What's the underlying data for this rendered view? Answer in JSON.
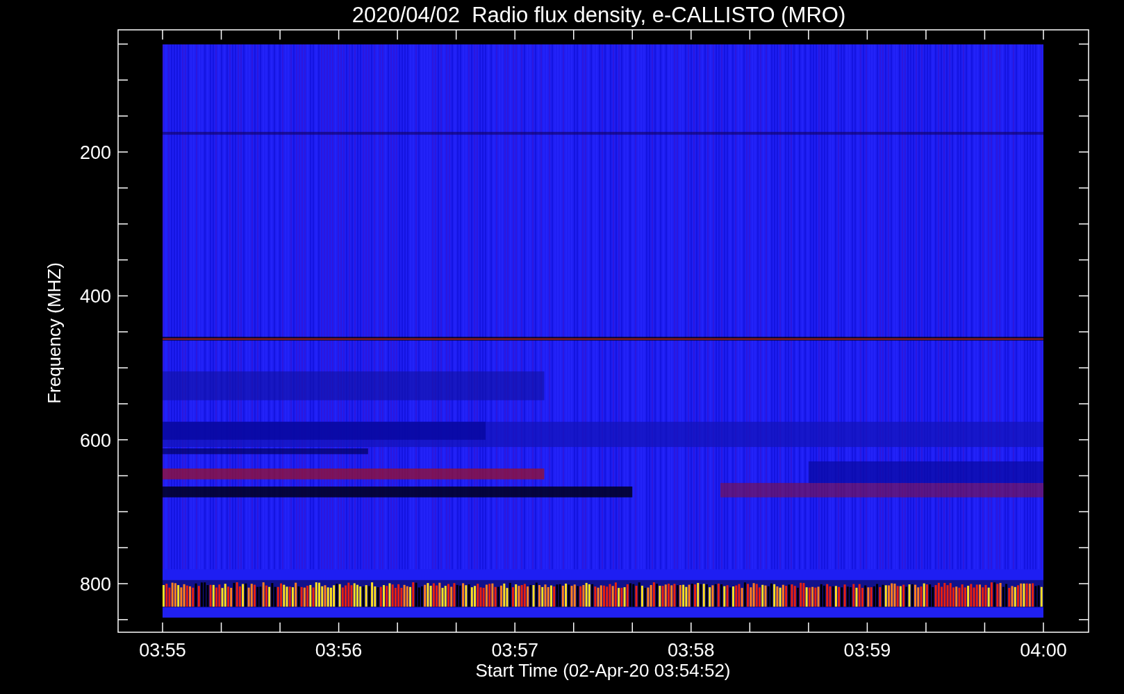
{
  "title": "2020/04/02  Radio flux density, e-CALLISTO (MRO)",
  "y_axis": {
    "label": "Frequency (MHZ)",
    "ticks": [
      "200",
      "400",
      "600",
      "800"
    ]
  },
  "x_axis": {
    "label": "Start Time (02-Apr-20 03:54:52)",
    "ticks": [
      "03:55",
      "03:56",
      "03:57",
      "03:58",
      "03:59",
      "04:00"
    ]
  }
}
